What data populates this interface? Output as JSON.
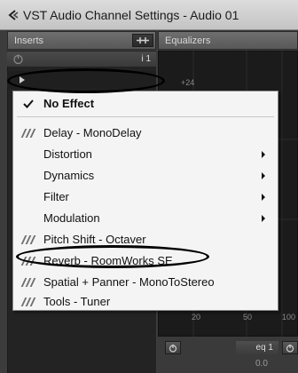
{
  "window": {
    "title": "VST Audio Channel Settings - Audio 01",
    "icon": "back-arrow-icon"
  },
  "inserts": {
    "header_label": "Inserts",
    "slot_number": "i 1"
  },
  "equalizers": {
    "header_label": "Equalizers",
    "db_label": "+24",
    "freq_labels": [
      "20",
      "50",
      "100"
    ],
    "band_label": "eq 1",
    "band_value": "0.0"
  },
  "menu": {
    "items": [
      {
        "label": "No Effect",
        "checked": true,
        "bold": true,
        "plugin": false,
        "submenu": false
      },
      {
        "label": "Delay - MonoDelay",
        "checked": false,
        "bold": false,
        "plugin": true,
        "submenu": false
      },
      {
        "label": "Distortion",
        "checked": false,
        "bold": false,
        "plugin": false,
        "submenu": true
      },
      {
        "label": "Dynamics",
        "checked": false,
        "bold": false,
        "plugin": false,
        "submenu": true
      },
      {
        "label": "Filter",
        "checked": false,
        "bold": false,
        "plugin": false,
        "submenu": true
      },
      {
        "label": "Modulation",
        "checked": false,
        "bold": false,
        "plugin": false,
        "submenu": true
      },
      {
        "label": "Pitch Shift - Octaver",
        "checked": false,
        "bold": false,
        "plugin": true,
        "submenu": false
      },
      {
        "label": "Reverb - RoomWorks SE",
        "checked": false,
        "bold": false,
        "plugin": true,
        "submenu": false
      },
      {
        "label": "Spatial + Panner - MonoToStereo",
        "checked": false,
        "bold": false,
        "plugin": true,
        "submenu": false
      },
      {
        "label": "Tools - Tuner",
        "checked": false,
        "bold": false,
        "plugin": true,
        "submenu": false
      }
    ]
  },
  "colors": {
    "menu_background": "#f4f4f4",
    "panel_dark": "#232323",
    "annotation": "#000000"
  }
}
